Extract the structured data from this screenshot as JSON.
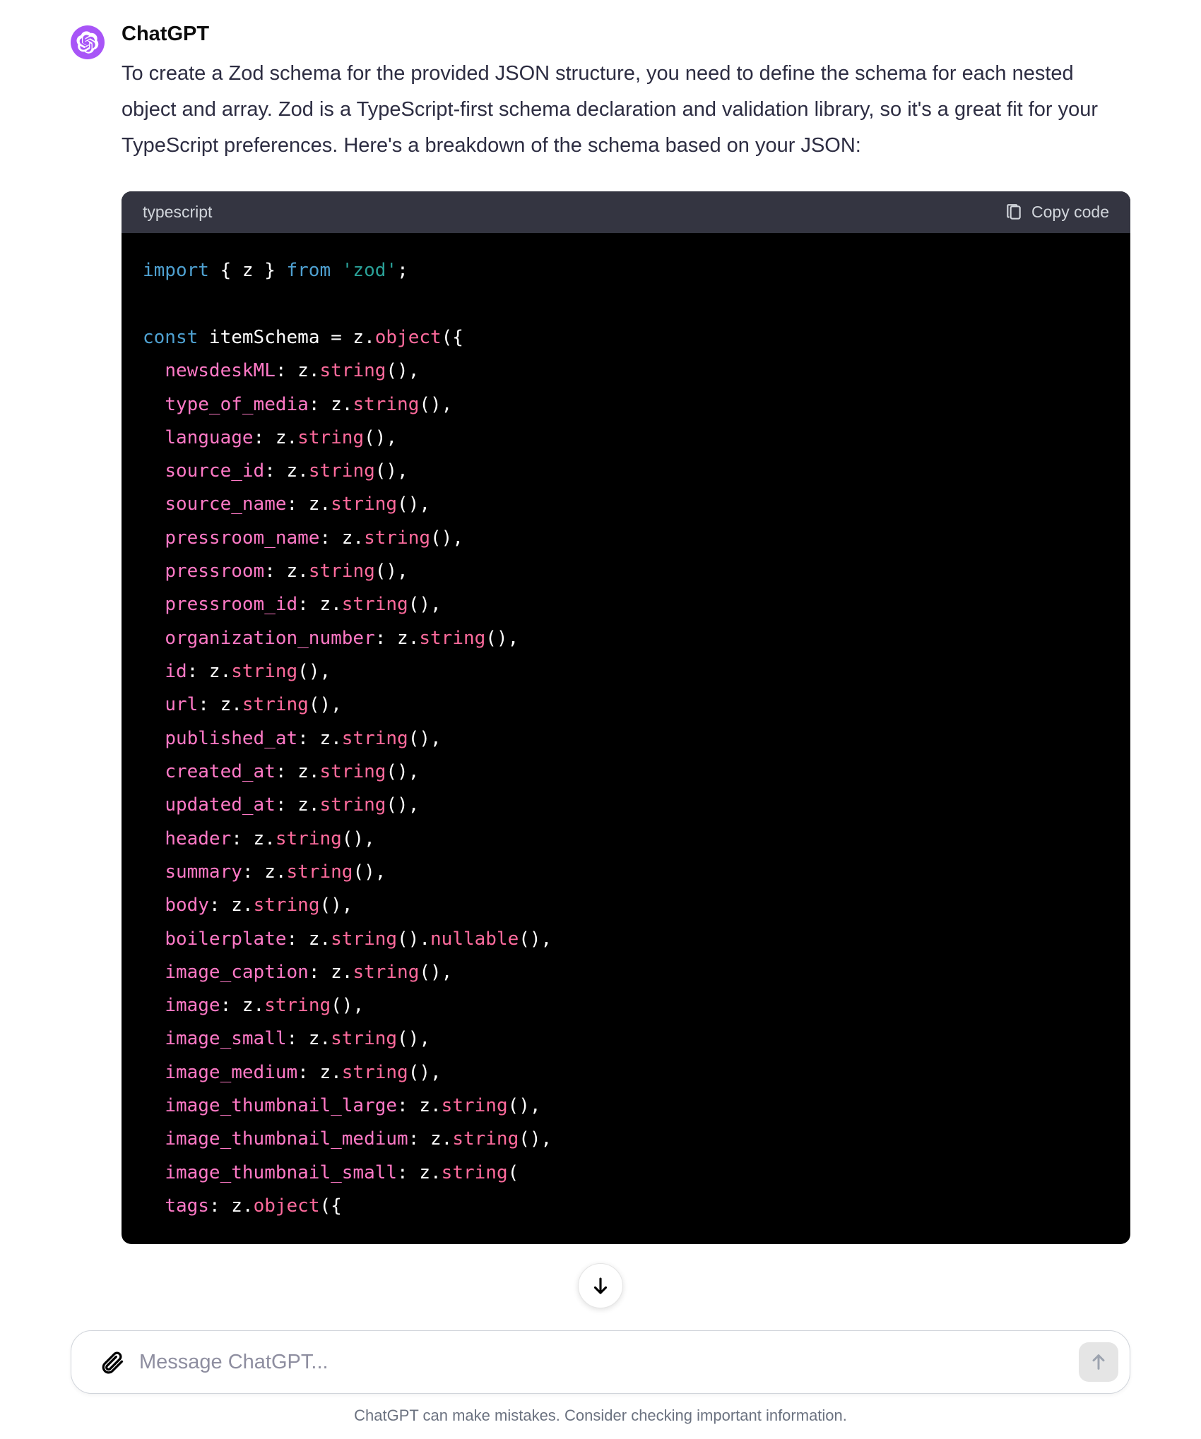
{
  "author": "ChatGPT",
  "message_text": "To create a Zod schema for the provided JSON structure, you need to define the schema for each nested object and array. Zod is a TypeScript-first schema declaration and validation library, so it's a great fit for your TypeScript preferences. Here's a breakdown of the schema based on your JSON:",
  "code": {
    "language_label": "typescript",
    "copy_label": "Copy code",
    "tokens": [
      [
        {
          "t": "kw",
          "v": "import"
        },
        {
          "t": "punc",
          "v": " { z } "
        },
        {
          "t": "kw",
          "v": "from"
        },
        {
          "t": "punc",
          "v": " "
        },
        {
          "t": "str",
          "v": "'zod'"
        },
        {
          "t": "punc",
          "v": ";"
        }
      ],
      [],
      [
        {
          "t": "kw",
          "v": "const"
        },
        {
          "t": "punc",
          "v": " itemSchema = z."
        },
        {
          "t": "method",
          "v": "object"
        },
        {
          "t": "punc",
          "v": "({"
        }
      ],
      [
        {
          "t": "punc",
          "v": "  "
        },
        {
          "t": "prop",
          "v": "newsdeskML"
        },
        {
          "t": "punc",
          "v": ": z."
        },
        {
          "t": "method",
          "v": "string"
        },
        {
          "t": "punc",
          "v": "(),"
        }
      ],
      [
        {
          "t": "punc",
          "v": "  "
        },
        {
          "t": "prop",
          "v": "type_of_media"
        },
        {
          "t": "punc",
          "v": ": z."
        },
        {
          "t": "method",
          "v": "string"
        },
        {
          "t": "punc",
          "v": "(),"
        }
      ],
      [
        {
          "t": "punc",
          "v": "  "
        },
        {
          "t": "prop",
          "v": "language"
        },
        {
          "t": "punc",
          "v": ": z."
        },
        {
          "t": "method",
          "v": "string"
        },
        {
          "t": "punc",
          "v": "(),"
        }
      ],
      [
        {
          "t": "punc",
          "v": "  "
        },
        {
          "t": "prop",
          "v": "source_id"
        },
        {
          "t": "punc",
          "v": ": z."
        },
        {
          "t": "method",
          "v": "string"
        },
        {
          "t": "punc",
          "v": "(),"
        }
      ],
      [
        {
          "t": "punc",
          "v": "  "
        },
        {
          "t": "prop",
          "v": "source_name"
        },
        {
          "t": "punc",
          "v": ": z."
        },
        {
          "t": "method",
          "v": "string"
        },
        {
          "t": "punc",
          "v": "(),"
        }
      ],
      [
        {
          "t": "punc",
          "v": "  "
        },
        {
          "t": "prop",
          "v": "pressroom_name"
        },
        {
          "t": "punc",
          "v": ": z."
        },
        {
          "t": "method",
          "v": "string"
        },
        {
          "t": "punc",
          "v": "(),"
        }
      ],
      [
        {
          "t": "punc",
          "v": "  "
        },
        {
          "t": "prop",
          "v": "pressroom"
        },
        {
          "t": "punc",
          "v": ": z."
        },
        {
          "t": "method",
          "v": "string"
        },
        {
          "t": "punc",
          "v": "(),"
        }
      ],
      [
        {
          "t": "punc",
          "v": "  "
        },
        {
          "t": "prop",
          "v": "pressroom_id"
        },
        {
          "t": "punc",
          "v": ": z."
        },
        {
          "t": "method",
          "v": "string"
        },
        {
          "t": "punc",
          "v": "(),"
        }
      ],
      [
        {
          "t": "punc",
          "v": "  "
        },
        {
          "t": "prop",
          "v": "organization_number"
        },
        {
          "t": "punc",
          "v": ": z."
        },
        {
          "t": "method",
          "v": "string"
        },
        {
          "t": "punc",
          "v": "(),"
        }
      ],
      [
        {
          "t": "punc",
          "v": "  "
        },
        {
          "t": "prop",
          "v": "id"
        },
        {
          "t": "punc",
          "v": ": z."
        },
        {
          "t": "method",
          "v": "string"
        },
        {
          "t": "punc",
          "v": "(),"
        }
      ],
      [
        {
          "t": "punc",
          "v": "  "
        },
        {
          "t": "prop",
          "v": "url"
        },
        {
          "t": "punc",
          "v": ": z."
        },
        {
          "t": "method",
          "v": "string"
        },
        {
          "t": "punc",
          "v": "(),"
        }
      ],
      [
        {
          "t": "punc",
          "v": "  "
        },
        {
          "t": "prop",
          "v": "published_at"
        },
        {
          "t": "punc",
          "v": ": z."
        },
        {
          "t": "method",
          "v": "string"
        },
        {
          "t": "punc",
          "v": "(),"
        }
      ],
      [
        {
          "t": "punc",
          "v": "  "
        },
        {
          "t": "prop",
          "v": "created_at"
        },
        {
          "t": "punc",
          "v": ": z."
        },
        {
          "t": "method",
          "v": "string"
        },
        {
          "t": "punc",
          "v": "(),"
        }
      ],
      [
        {
          "t": "punc",
          "v": "  "
        },
        {
          "t": "prop",
          "v": "updated_at"
        },
        {
          "t": "punc",
          "v": ": z."
        },
        {
          "t": "method",
          "v": "string"
        },
        {
          "t": "punc",
          "v": "(),"
        }
      ],
      [
        {
          "t": "punc",
          "v": "  "
        },
        {
          "t": "prop",
          "v": "header"
        },
        {
          "t": "punc",
          "v": ": z."
        },
        {
          "t": "method",
          "v": "string"
        },
        {
          "t": "punc",
          "v": "(),"
        }
      ],
      [
        {
          "t": "punc",
          "v": "  "
        },
        {
          "t": "prop",
          "v": "summary"
        },
        {
          "t": "punc",
          "v": ": z."
        },
        {
          "t": "method",
          "v": "string"
        },
        {
          "t": "punc",
          "v": "(),"
        }
      ],
      [
        {
          "t": "punc",
          "v": "  "
        },
        {
          "t": "prop",
          "v": "body"
        },
        {
          "t": "punc",
          "v": ": z."
        },
        {
          "t": "method",
          "v": "string"
        },
        {
          "t": "punc",
          "v": "(),"
        }
      ],
      [
        {
          "t": "punc",
          "v": "  "
        },
        {
          "t": "prop",
          "v": "boilerplate"
        },
        {
          "t": "punc",
          "v": ": z."
        },
        {
          "t": "method",
          "v": "string"
        },
        {
          "t": "punc",
          "v": "()."
        },
        {
          "t": "method",
          "v": "nullable"
        },
        {
          "t": "punc",
          "v": "(),"
        }
      ],
      [
        {
          "t": "punc",
          "v": "  "
        },
        {
          "t": "prop",
          "v": "image_caption"
        },
        {
          "t": "punc",
          "v": ": z."
        },
        {
          "t": "method",
          "v": "string"
        },
        {
          "t": "punc",
          "v": "(),"
        }
      ],
      [
        {
          "t": "punc",
          "v": "  "
        },
        {
          "t": "prop",
          "v": "image"
        },
        {
          "t": "punc",
          "v": ": z."
        },
        {
          "t": "method",
          "v": "string"
        },
        {
          "t": "punc",
          "v": "(),"
        }
      ],
      [
        {
          "t": "punc",
          "v": "  "
        },
        {
          "t": "prop",
          "v": "image_small"
        },
        {
          "t": "punc",
          "v": ": z."
        },
        {
          "t": "method",
          "v": "string"
        },
        {
          "t": "punc",
          "v": "(),"
        }
      ],
      [
        {
          "t": "punc",
          "v": "  "
        },
        {
          "t": "prop",
          "v": "image_medium"
        },
        {
          "t": "punc",
          "v": ": z."
        },
        {
          "t": "method",
          "v": "string"
        },
        {
          "t": "punc",
          "v": "(),"
        }
      ],
      [
        {
          "t": "punc",
          "v": "  "
        },
        {
          "t": "prop",
          "v": "image_thumbnail_large"
        },
        {
          "t": "punc",
          "v": ": z."
        },
        {
          "t": "method",
          "v": "string"
        },
        {
          "t": "punc",
          "v": "(),"
        }
      ],
      [
        {
          "t": "punc",
          "v": "  "
        },
        {
          "t": "prop",
          "v": "image_thumbnail_medium"
        },
        {
          "t": "punc",
          "v": ": z."
        },
        {
          "t": "method",
          "v": "string"
        },
        {
          "t": "punc",
          "v": "(),"
        }
      ],
      [
        {
          "t": "punc",
          "v": "  "
        },
        {
          "t": "prop",
          "v": "image_thumbnail_small"
        },
        {
          "t": "punc",
          "v": ": z."
        },
        {
          "t": "method",
          "v": "string"
        },
        {
          "t": "punc",
          "v": "("
        }
      ],
      [
        {
          "t": "punc",
          "v": "  "
        },
        {
          "t": "prop",
          "v": "tags"
        },
        {
          "t": "punc",
          "v": ": z."
        },
        {
          "t": "method",
          "v": "object"
        },
        {
          "t": "punc",
          "v": "({"
        }
      ]
    ]
  },
  "input": {
    "placeholder": "Message ChatGPT..."
  },
  "disclaimer": "ChatGPT can make mistakes. Consider checking important information.",
  "colors": {
    "avatar_bg": "#a855f7",
    "code_header_bg": "#343541",
    "code_bg": "#000000"
  }
}
